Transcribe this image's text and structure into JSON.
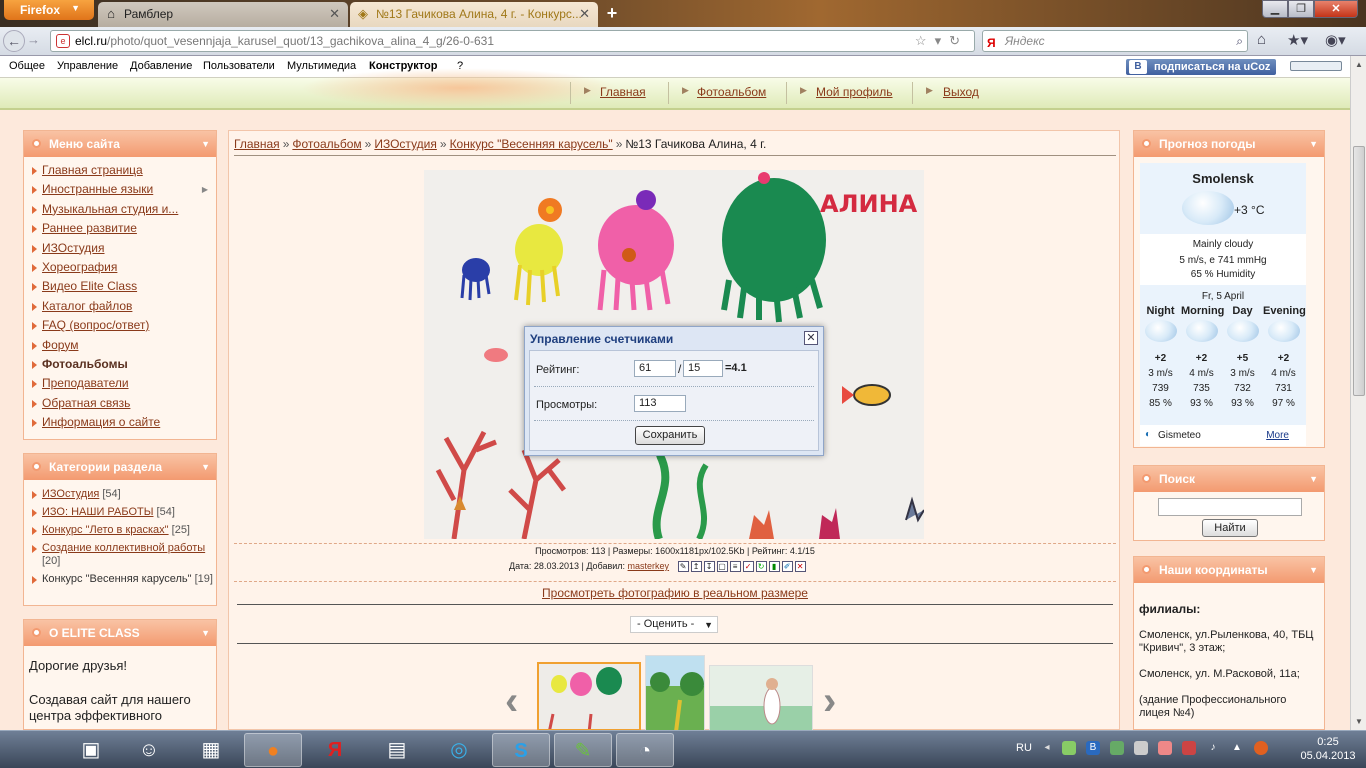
{
  "browser": {
    "menu_button": "Firefox",
    "tabs": [
      {
        "title": "Рамблер",
        "icon": "home-icon"
      },
      {
        "title": "№13 Гачикова Алина, 4 г. - Конкурс...",
        "icon": "page-icon"
      }
    ],
    "url_host": "elcl.ru",
    "url_path": "/photo/quot_vesennjaja_karusel_quot/13_gachikova_alina_4_g/26-0-631",
    "search_placeholder": "Яндекс",
    "search_engine_glyph": "Я"
  },
  "ucoz_bar": {
    "items": [
      "Общее",
      "Управление",
      "Добавление",
      "Пользователи",
      "Мультимедиа",
      "Конструктор",
      "?"
    ],
    "subscribe": "подписаться на uCoz",
    "subscribe_badge": "B"
  },
  "top_nav": [
    "Главная",
    "Фотоальбом",
    "Мой профиль",
    "Выход"
  ],
  "site_menu": {
    "title": "Меню сайта",
    "items": [
      {
        "label": "Главная страница"
      },
      {
        "label": "Иностранные языки",
        "has_submenu": true
      },
      {
        "label": "Музыкальная студия и..."
      },
      {
        "label": "Раннее развитие"
      },
      {
        "label": "ИЗОстудия"
      },
      {
        "label": "Хореография"
      },
      {
        "label": "Видео Elite Class"
      },
      {
        "label": "Каталог файлов"
      },
      {
        "label": "FAQ (вопрос/ответ)"
      },
      {
        "label": "Форум"
      },
      {
        "label": "Фотоальбомы",
        "active": true
      },
      {
        "label": "Преподаватели"
      },
      {
        "label": "Обратная связь"
      },
      {
        "label": "Информация о сайте"
      }
    ]
  },
  "categories": {
    "title": "Категории раздела",
    "items": [
      {
        "label": "ИЗОстудия",
        "count": "[54]"
      },
      {
        "label": "ИЗО: НАШИ РАБОТЫ",
        "count": "[54]"
      },
      {
        "label": "Конкурс \"Лето в красках\"",
        "count": "[25]"
      },
      {
        "label": "Создание коллективной работы",
        "count": "[20]"
      },
      {
        "label": "Конкурс \"Весенняя карусель\"",
        "count": "[19]"
      }
    ]
  },
  "about": {
    "title": "О ELITE CLASS",
    "line1": "Дорогие друзья!",
    "line2": "Создавая сайт для нашего",
    "line3": "центра эффективного"
  },
  "breadcrumbs": {
    "links": [
      "Главная",
      "Фотоальбом",
      "ИЗОстудия",
      "Конкурс \"Весенняя карусель\""
    ],
    "separator": "»",
    "current": "№13 Гачикова Алина, 4 г."
  },
  "photo": {
    "drawing_text": "АЛИНА",
    "meta_line1": "Просмотров: 113 | Размеры: 1600x1181px/102.5Kb | Рейтинг: 4.1/15",
    "meta_date": "Дата: 28.03.2013 | Добавил:",
    "added_by": "masterkey",
    "view_full": "Просмотреть фотографию в реальном размере",
    "rate_select": "- Оценить -"
  },
  "dialog": {
    "title": "Управление счетчиками",
    "rating_label": "Рейтинг:",
    "rating_sum": "61",
    "rating_slash": "/",
    "rating_votes": "15",
    "rating_result": "=4.1",
    "views_label": "Просмотры:",
    "views_value": "113",
    "save": "Сохранить",
    "close_glyph": "✕"
  },
  "weather": {
    "title": "Прогноз погоды",
    "city": "Smolensk",
    "temp": "+3 °C",
    "condition": "Mainly cloudy",
    "wind_pressure": "5 m/s, e  741 mmHg",
    "humidity": "65 % Humidity",
    "date": "Fr, 5 April",
    "periods": [
      {
        "name": "Night",
        "temp": "+2",
        "wind": "3 m/s",
        "pressure": "739",
        "humidity": "85 %"
      },
      {
        "name": "Morning",
        "temp": "+2",
        "wind": "4 m/s",
        "pressure": "735",
        "humidity": "93 %"
      },
      {
        "name": "Day",
        "temp": "+5",
        "wind": "3 m/s",
        "pressure": "732",
        "humidity": "93 %"
      },
      {
        "name": "Evening",
        "temp": "+2",
        "wind": "4 m/s",
        "pressure": "731",
        "humidity": "97 %"
      }
    ],
    "provider": "Gismeteo",
    "more": "More"
  },
  "search_box": {
    "title": "Поиск",
    "button": "Найти"
  },
  "coordinates": {
    "title": "Наши координаты",
    "heading": "филиалы:",
    "address1": "Смоленск, ул.Рыленкова, 40, ТБЦ \"Кривич\", 3 этаж;",
    "address2": "Смоленск, ул. М.Расковой, 11а;",
    "address3": "(здание Профессионального лицея №4)"
  },
  "taskbar": {
    "lang": "RU",
    "time": "0:25",
    "date": "05.04.2013",
    "apps": [
      "apple-icon",
      "camera-icon",
      "finder-icon",
      "calculator-icon",
      "firefox-icon",
      "yandex-icon",
      "video-icon",
      "qip-icon",
      "skype-icon",
      "evernote-icon",
      "dashboard-icon"
    ]
  },
  "colors": {
    "accent": "#f39a70",
    "link": "#8a3a1a",
    "page_bg": "#fde9dc",
    "dialog_title": "#1f3f7f"
  }
}
